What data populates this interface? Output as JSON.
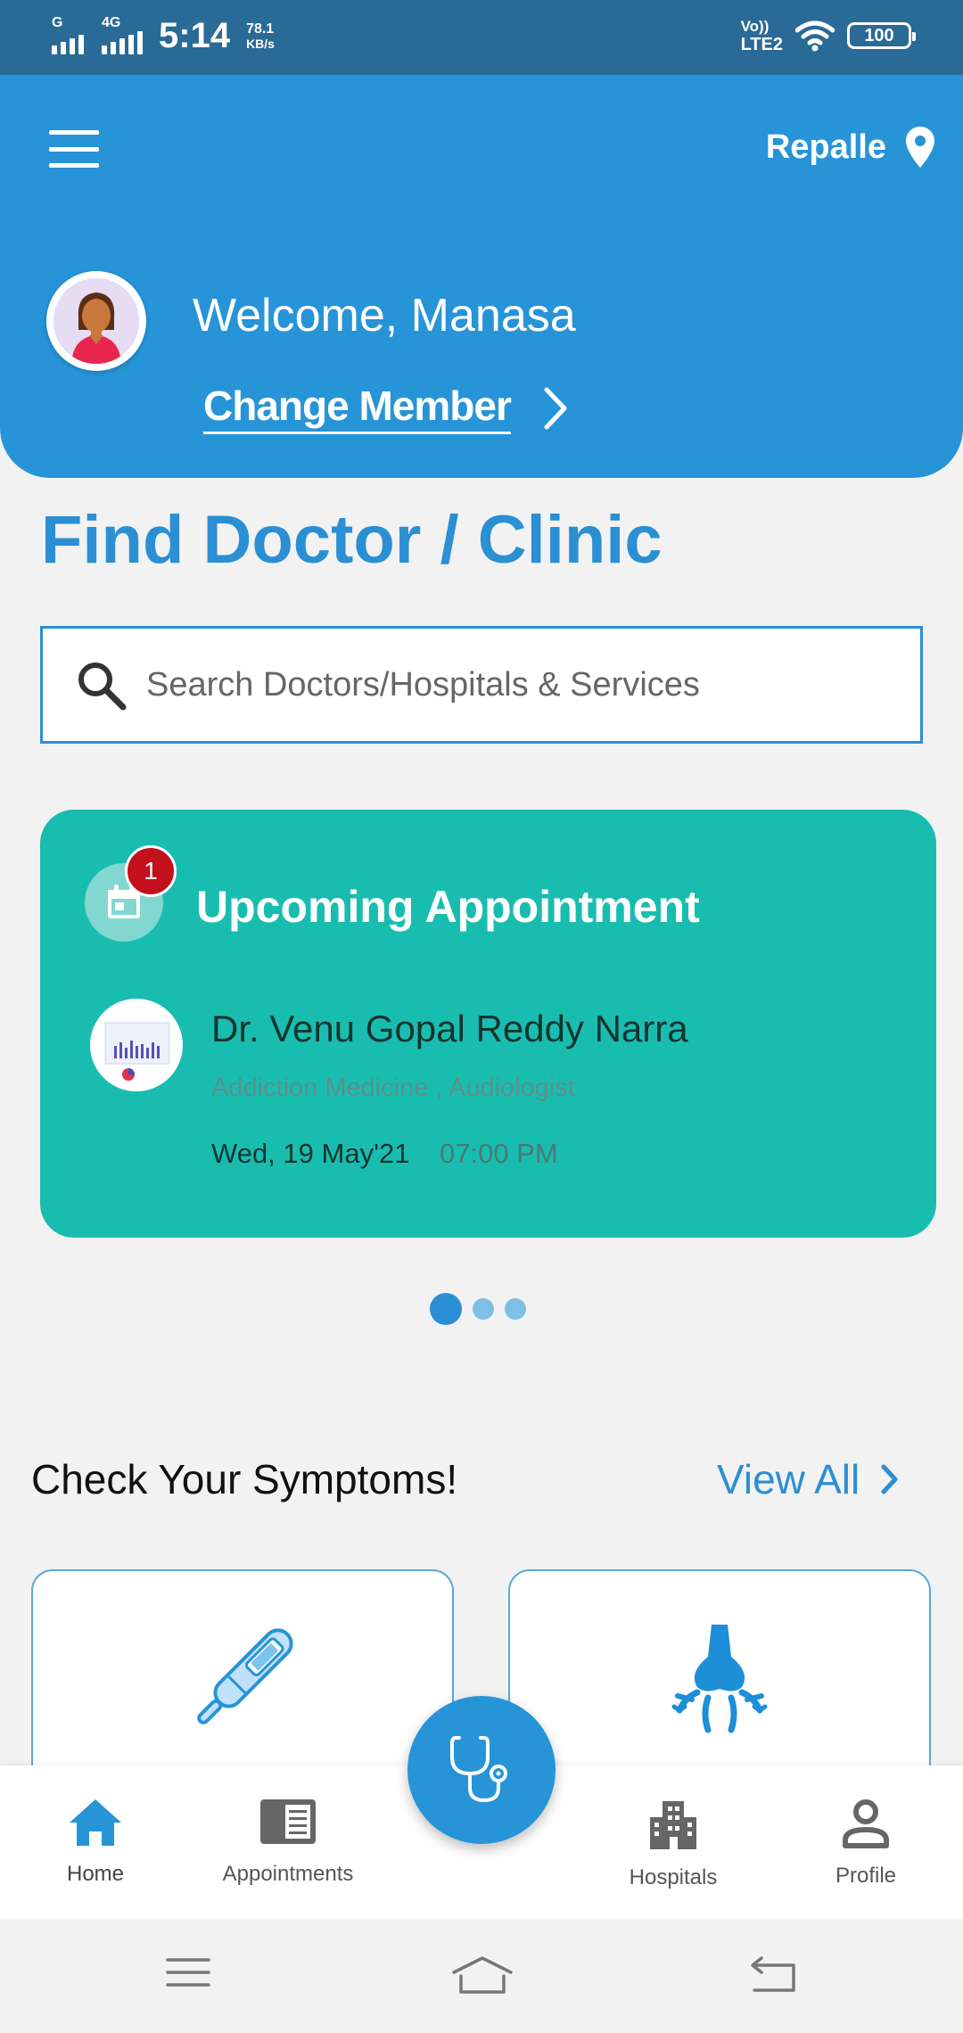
{
  "status_bar": {
    "sim1_label": "G",
    "sim2_label": "4G",
    "time": "5:14",
    "net_speed_value": "78.1",
    "net_speed_unit": "KB/s",
    "volte_top": "Vo))",
    "volte_bottom": "LTE2",
    "battery": "100"
  },
  "header": {
    "location": "Repalle",
    "welcome": "Welcome, Manasa",
    "change_member": "Change Member",
    "brand_color": "#2794d8"
  },
  "main": {
    "title": "Find Doctor / Clinic",
    "search_placeholder": "Search Doctors/Hospitals & Services"
  },
  "appointment": {
    "title": "Upcoming Appointment",
    "badge_count": "1",
    "doctor_name": "Dr. Venu Gopal Reddy Narra",
    "specialty": "Addiction Medicine , Audiologist",
    "date": "Wed, 19 May'21",
    "time": "07:00 PM",
    "card_color": "#19bdb0"
  },
  "carousel": {
    "total": 3,
    "active_index": 0
  },
  "symptoms": {
    "title": "Check Your Symptoms!",
    "view_all": "View All",
    "cards": [
      {
        "icon": "thermometer-icon"
      },
      {
        "icon": "nose-icon"
      }
    ]
  },
  "bottom_nav": {
    "items": [
      {
        "label": "Home",
        "icon": "home-icon"
      },
      {
        "label": "Appointments",
        "icon": "appointments-icon"
      },
      {
        "label": "Hospitals",
        "icon": "hospital-icon"
      },
      {
        "label": "Profile",
        "icon": "profile-icon"
      }
    ],
    "fab_icon": "stethoscope-icon"
  }
}
